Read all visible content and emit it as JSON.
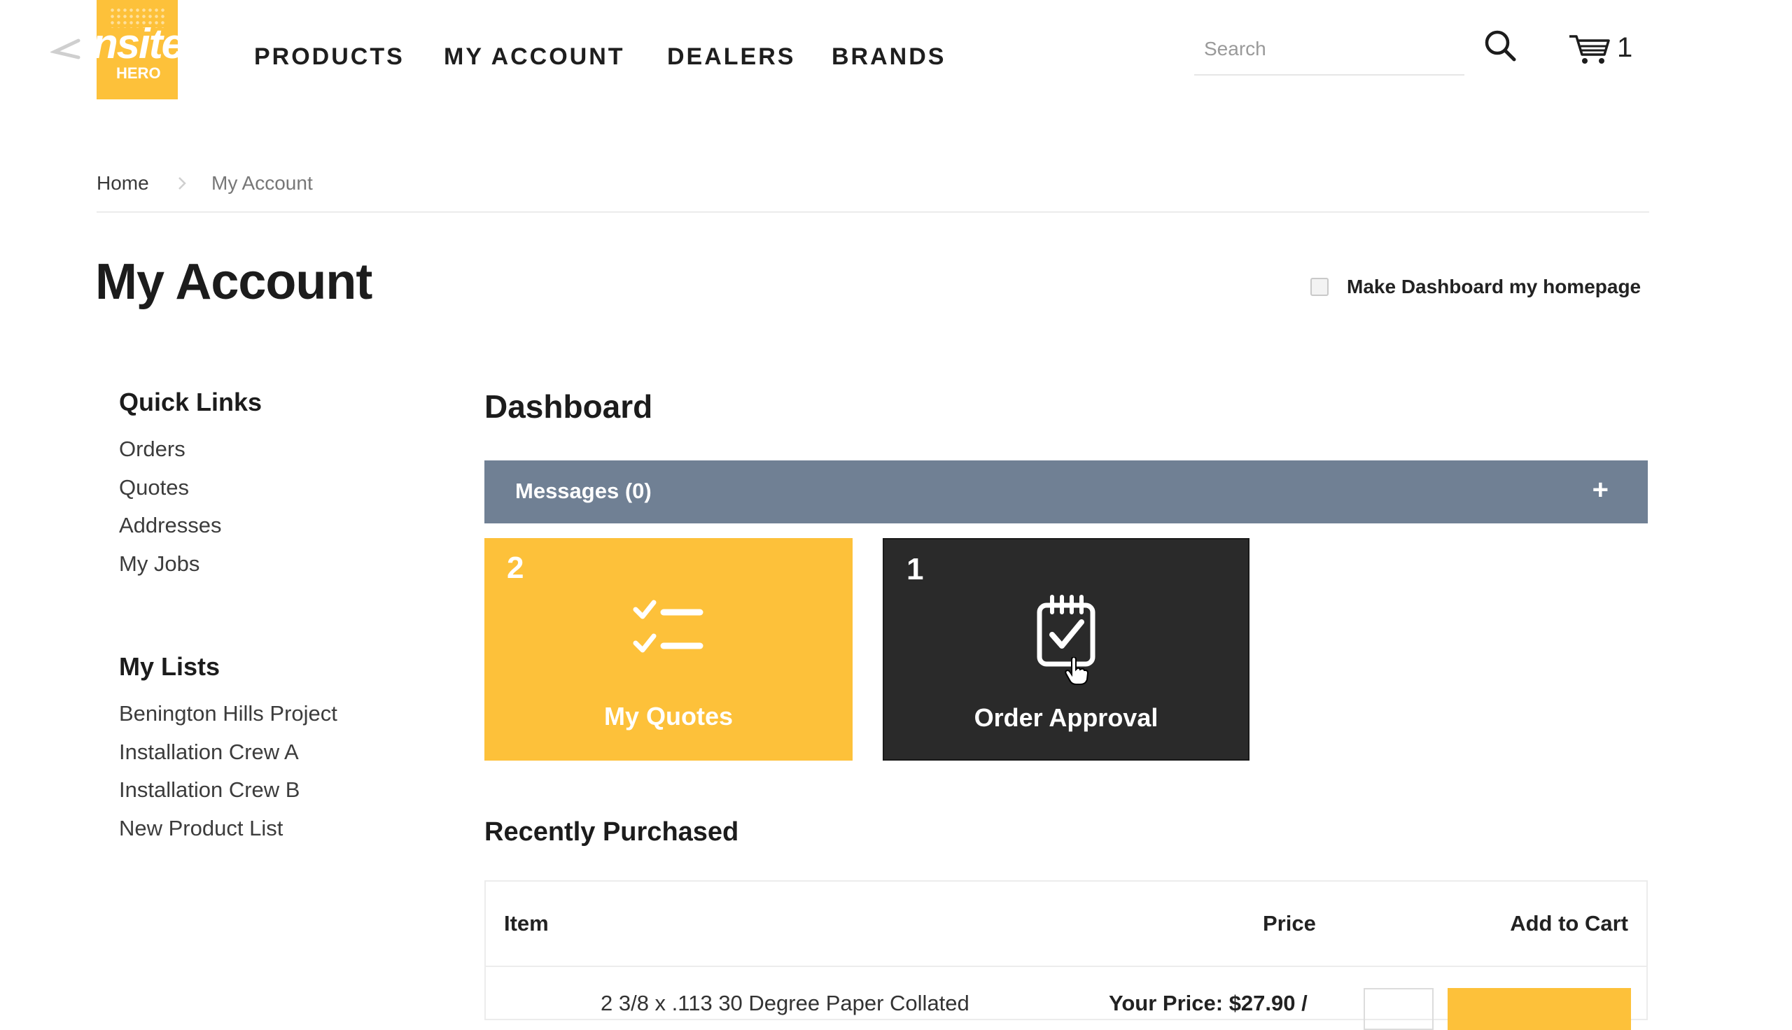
{
  "header": {
    "logo_text": "nsite",
    "logo_subtext": "HERO",
    "nav": [
      "PRODUCTS",
      "MY ACCOUNT",
      "DEALERS",
      "BRANDS"
    ],
    "search_placeholder": "Search",
    "cart_count": "1"
  },
  "breadcrumb": {
    "home": "Home",
    "current": "My Account"
  },
  "page_title": "My Account",
  "homepage_toggle": {
    "label": "Make Dashboard my homepage",
    "checked": false
  },
  "sidebar": {
    "quick_links_heading": "Quick Links",
    "quick_links": [
      "Orders",
      "Quotes",
      "Addresses",
      "My Jobs"
    ],
    "my_lists_heading": "My Lists",
    "my_lists": [
      "Benington Hills Project",
      "Installation Crew A",
      "Installation Crew B",
      "New Product List"
    ]
  },
  "dashboard": {
    "heading": "Dashboard",
    "messages_label": "Messages (0)",
    "messages_expand": "+",
    "tiles": [
      {
        "count": "2",
        "label": "My Quotes",
        "icon": "checklist-icon",
        "color": "#fdc13a"
      },
      {
        "count": "1",
        "label": "Order Approval",
        "icon": "clipboard-check-icon",
        "color": "#2a2a2a"
      }
    ]
  },
  "recently_purchased": {
    "heading": "Recently Purchased",
    "columns": {
      "item": "Item",
      "price": "Price",
      "add_to_cart": "Add to Cart"
    },
    "rows": [
      {
        "item": "2 3/8 x .113 30 Degree Paper Collated",
        "price": "Your Price: $27.90 /"
      }
    ]
  },
  "colors": {
    "accent": "#fdc13a",
    "messages_bar": "#708094",
    "dark_tile": "#2a2a2a"
  }
}
